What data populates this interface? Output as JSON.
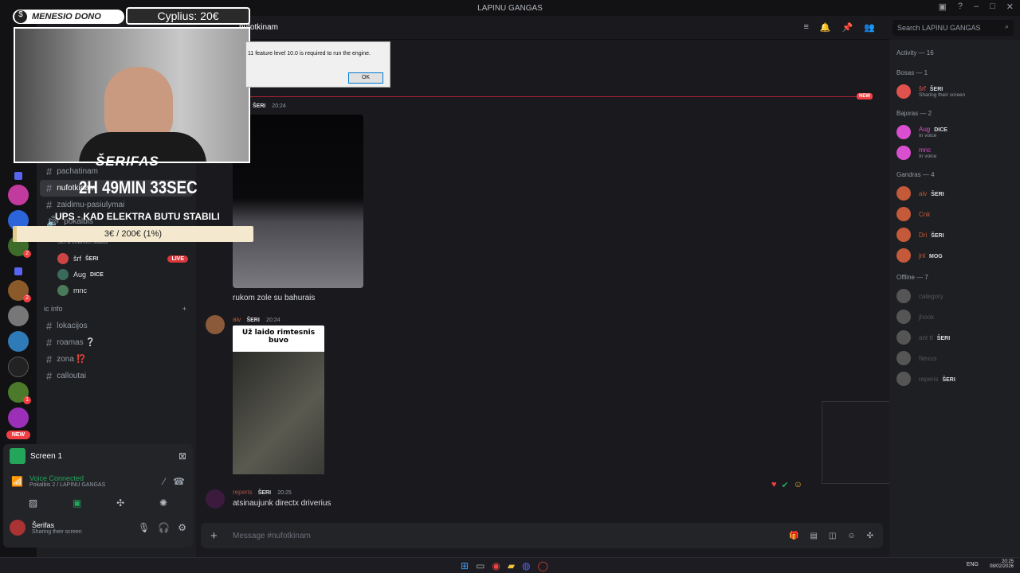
{
  "window": {
    "title": "LAPINU GANGAS"
  },
  "server": {
    "name": "LAPINU GANGAS"
  },
  "channel": {
    "name": "nufotkinam"
  },
  "search": {
    "placeholder": "Search LAPINU GANGAS"
  },
  "overlay": {
    "donate_label": "MENESIO DONO",
    "donate_amount": "Cyplius: 20€",
    "streamer": "ŠERIFAS",
    "timer": "2H 49MIN 33SEC",
    "goal_title": "UPS - KAD ELEKTRA BUTU STABILI",
    "goal_progress": "3€ / 200€ (1%)",
    "goal_fraction": 0.015
  },
  "dialog": {
    "text": "11 feature level 10.0 is required to run the engine.",
    "ok": "OK"
  },
  "channels": {
    "list_top": [
      "pachatinam",
      "nufotkinam",
      "zaidimu-pasiulymai",
      "pokalbis"
    ],
    "status_placeholder": "Set a channel status",
    "voice_users": [
      {
        "name": "šrf",
        "tag": "ŠERI",
        "live": "LIVE"
      },
      {
        "name": "Aug",
        "tag": "DICE"
      },
      {
        "name": "mnc"
      }
    ],
    "category": "ic info",
    "list_bottom": [
      "lokacijos",
      "roamas ❔",
      "zona ⁉️",
      "calloutai"
    ]
  },
  "user_panel": {
    "screen": "Screen 1",
    "voice_status": "Voice Connected",
    "voice_location": "Pokalbis 2 / LAPINU GANGAS",
    "username": "Šerifas",
    "user_status": "Sharing their screen"
  },
  "messages": {
    "new_label": "NEW",
    "m1": {
      "tag": "ŠERI",
      "time": "20:24",
      "text": "rukom zole su bahurais"
    },
    "m2": {
      "author": "aiv",
      "tag": "ŠERI",
      "time": "20:24",
      "meme": "Už laido rimtesnis buvo"
    },
    "m3": {
      "author": "reperis",
      "tag": "ŠERI",
      "time": "20:25",
      "text": "atsinaujunk directx driverius"
    }
  },
  "input": {
    "placeholder": "Message #nufotkinam"
  },
  "members": {
    "activity": "Activity — 16",
    "groups": [
      {
        "title": "Bosas — 1",
        "members": [
          {
            "name": "šrf",
            "tag": "ŠERI",
            "sub": "Sharing their screen",
            "color": "#e0524d"
          }
        ]
      },
      {
        "title": "Bajoras — 2",
        "members": [
          {
            "name": "Aug",
            "tag": "DICE",
            "sub": "In voice",
            "color": "#d94fcf"
          },
          {
            "name": "mnc",
            "sub": "In voice",
            "color": "#d94fcf"
          }
        ]
      },
      {
        "title": "Gandras — 4",
        "members": [
          {
            "name": "aiv",
            "tag": "ŠERI",
            "color": "#c45a3a"
          },
          {
            "name": "Cnk",
            "color": "#c45a3a"
          },
          {
            "name": "Dri",
            "tag": "ŠERI",
            "color": "#c45a3a"
          },
          {
            "name": "jnl",
            "tag": "MOG",
            "color": "#c45a3a"
          }
        ]
      },
      {
        "title": "Offline — 7",
        "members": [
          {
            "name": "category",
            "color": "#555"
          },
          {
            "name": "jhook",
            "color": "#555"
          },
          {
            "name": "ant tt",
            "tag": "ŠERI",
            "color": "#555"
          },
          {
            "name": "Nexus",
            "color": "#555"
          },
          {
            "name": "reperis",
            "tag": "ŠERI",
            "color": "#555"
          }
        ]
      }
    ]
  },
  "taskbar": {
    "lang": "ENG",
    "time": "20:25",
    "date": "08/02/2026"
  }
}
